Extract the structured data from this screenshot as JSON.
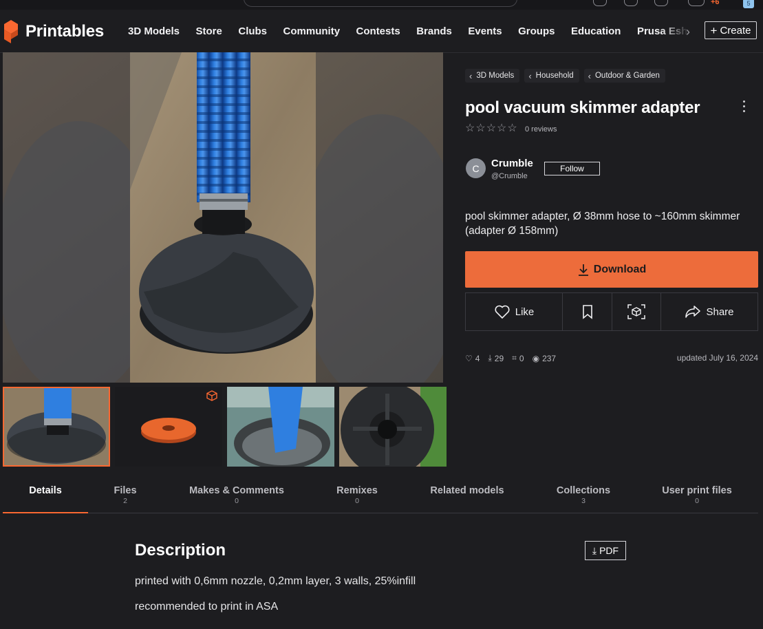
{
  "colors": {
    "accent": "#fa6831",
    "download_bg": "#ed6c3b",
    "background": "#1d1d20"
  },
  "topbar": {
    "notification_badge": "+6",
    "avatar_badge": "5"
  },
  "navbar": {
    "logo_text": "Printables",
    "links": [
      "3D Models",
      "Store",
      "Clubs",
      "Community",
      "Contests",
      "Brands",
      "Events",
      "Groups",
      "Education",
      "Prusa Eshop"
    ],
    "create_label": "Create"
  },
  "breadcrumbs": [
    "3D Models",
    "Household",
    "Outdoor & Garden"
  ],
  "model": {
    "title": "pool vacuum skimmer adapter",
    "rating_stars": 0,
    "reviews_label": "0 reviews",
    "summary": "pool skimmer adapter, Ø 38mm hose to ~160mm skimmer (adapter Ø 158mm)"
  },
  "author": {
    "initial": "C",
    "name": "Crumble",
    "handle": "@Crumble",
    "follow_label": "Follow"
  },
  "download_label": "Download",
  "actions": {
    "like_label": "Like",
    "share_label": "Share"
  },
  "stats": {
    "likes": "4",
    "downloads": "29",
    "makes": "0",
    "views": "237",
    "updated": "updated July 16, 2024"
  },
  "tabs": [
    {
      "label": "Details",
      "count": ""
    },
    {
      "label": "Files",
      "count": "2"
    },
    {
      "label": "Makes & Comments",
      "count": "0"
    },
    {
      "label": "Remixes",
      "count": "0"
    },
    {
      "label": "Related models",
      "count": ""
    },
    {
      "label": "Collections",
      "count": "3"
    },
    {
      "label": "User print files",
      "count": "0"
    }
  ],
  "description": {
    "heading": "Description",
    "pdf_label": "PDF",
    "paragraphs": [
      "printed with 0,6mm nozzle, 0,2mm layer, 3 walls, 25%infill",
      "recommended to print in ASA"
    ]
  }
}
